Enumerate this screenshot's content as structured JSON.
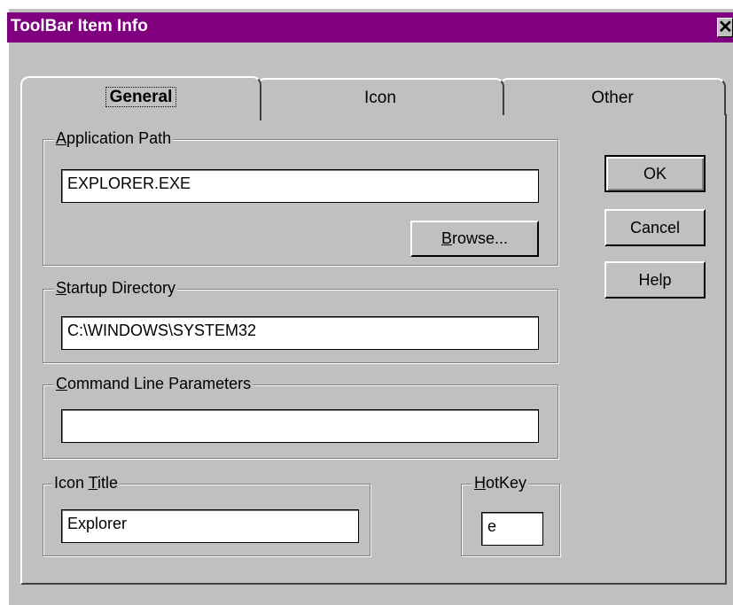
{
  "window": {
    "title": "ToolBar Item Info",
    "close_glyph": "✕"
  },
  "tabs": [
    {
      "label": "General",
      "selected": true
    },
    {
      "label": "Icon",
      "selected": false
    },
    {
      "label": "Other",
      "selected": false
    }
  ],
  "groups": {
    "app_path": {
      "label_hot": "A",
      "label_rest": "pplication Path",
      "value": "EXPLORER.EXE"
    },
    "browse": {
      "label_hot": "B",
      "label_rest": "rowse..."
    },
    "startup": {
      "label_hot": "S",
      "label_rest": "tartup Directory",
      "value": "C:\\WINDOWS\\SYSTEM32"
    },
    "cmdline": {
      "label_hot": "C",
      "label_rest": "ommand Line Parameters",
      "value": ""
    },
    "icon_title": {
      "label_pre": "Icon ",
      "label_hot": "T",
      "label_rest": "itle",
      "value": "Explorer"
    },
    "hotkey": {
      "label_hot": "H",
      "label_rest": "otKey",
      "value": "e"
    }
  },
  "buttons": {
    "ok": "OK",
    "cancel": "Cancel",
    "help": "Help"
  },
  "colors": {
    "title_bar": "#800080",
    "face": "#c0c0c0"
  }
}
